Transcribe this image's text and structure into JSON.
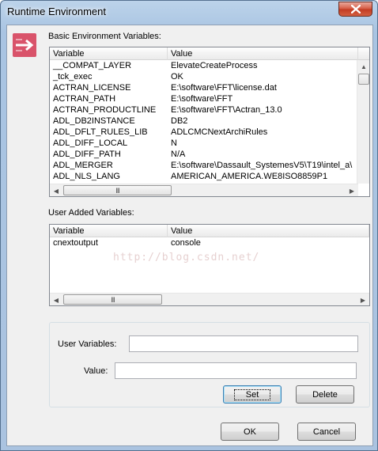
{
  "window": {
    "title": "Runtime Environment"
  },
  "basic": {
    "label": "Basic Environment Variables:",
    "columns": [
      "Variable",
      "Value"
    ],
    "rows": [
      {
        "variable": "__COMPAT_LAYER",
        "value": "ElevateCreateProcess"
      },
      {
        "variable": "_tck_exec",
        "value": "OK"
      },
      {
        "variable": "ACTRAN_LICENSE",
        "value": "E:\\software\\FFT\\license.dat"
      },
      {
        "variable": "ACTRAN_PATH",
        "value": "E:\\software\\FFT"
      },
      {
        "variable": "ACTRAN_PRODUCTLINE",
        "value": "E:\\software\\FFT\\Actran_13.0"
      },
      {
        "variable": "ADL_DB2INSTANCE",
        "value": "DB2"
      },
      {
        "variable": "ADL_DFLT_RULES_LIB",
        "value": "ADLCMCNextArchiRules"
      },
      {
        "variable": "ADL_DIFF_LOCAL",
        "value": "N"
      },
      {
        "variable": "ADL_DIFF_PATH",
        "value": "N/A"
      },
      {
        "variable": "ADL_MERGER",
        "value": "E:\\software\\Dassault_SystemesV5\\T19\\intel_a\\"
      },
      {
        "variable": "ADL_NLS_LANG",
        "value": "AMERICAN_AMERICA.WE8ISO8859P1"
      }
    ]
  },
  "user": {
    "label": "User Added Variables:",
    "columns": [
      "Variable",
      "Value"
    ],
    "rows": [
      {
        "variable": "cnextoutput",
        "value": "console"
      }
    ]
  },
  "form": {
    "user_variables_label": "User Variables:",
    "user_variables_value": "",
    "value_label": "Value:",
    "value_value": "",
    "set_label": "Set",
    "delete_label": "Delete"
  },
  "footer": {
    "ok_label": "OK",
    "cancel_label": "Cancel"
  },
  "scrollbar_grip": "III",
  "watermark": "http://blog.csdn.net/",
  "colors": {
    "icon": "#d9536a",
    "close": "#c9452d"
  }
}
